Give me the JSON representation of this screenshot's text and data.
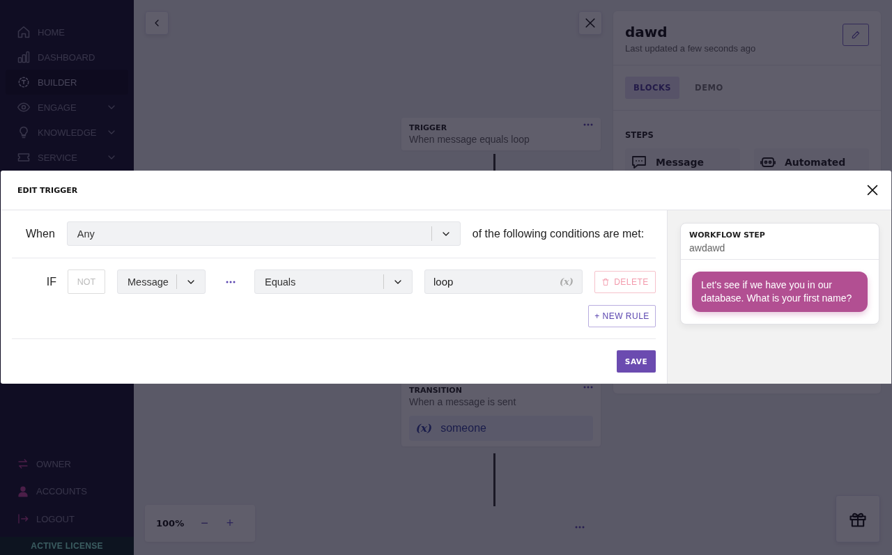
{
  "sidebar": {
    "items": [
      {
        "label": "HOME",
        "selected": false,
        "expandable": false
      },
      {
        "label": "DASHBOARD",
        "selected": false,
        "expandable": false
      },
      {
        "label": "BUILDER",
        "selected": true,
        "expandable": false
      },
      {
        "label": "ENGAGE",
        "selected": false,
        "expandable": true
      },
      {
        "label": "KNOWLEDGE",
        "selected": false,
        "expandable": true
      },
      {
        "label": "SERVICE",
        "selected": false,
        "expandable": true
      }
    ],
    "bottom_items": [
      {
        "label": "OWNER"
      },
      {
        "label": "ACCOUNTS"
      },
      {
        "label": "LOGOUT"
      }
    ],
    "license": "ACTIVE LICENSE"
  },
  "canvas": {
    "nodes": [
      {
        "kind": "trigger",
        "title": "TRIGGER",
        "subtitle": "When message equals loop"
      },
      {
        "kind": "transition",
        "title": "TRANSITION",
        "subtitle": "When a message is sent",
        "variable_icon": "(x)",
        "variable": "someone"
      }
    ],
    "zoom": {
      "value": "100%",
      "zoom_out": "−",
      "zoom_in": "+"
    }
  },
  "panel": {
    "title": "dawd",
    "updated": "Last updated a few seconds ago",
    "tabs": [
      {
        "label": "BLOCKS",
        "selected": true
      },
      {
        "label": "DEMO",
        "selected": false
      }
    ],
    "steps_heading": "STEPS",
    "steps": [
      {
        "label": "Message"
      },
      {
        "label": "Automated"
      }
    ]
  },
  "modal": {
    "title": "EDIT TRIGGER",
    "when_label": "When",
    "match": "Any",
    "match_suffix": "of the following conditions are met:",
    "rules": [
      {
        "prefix": "IF",
        "not_label": "NOT",
        "negated": false,
        "field": "Message",
        "operator": "Equals",
        "value": "loop",
        "variable_icon": "(x)",
        "delete": "DELETE"
      }
    ],
    "new_rule": "+ NEW RULE",
    "save": "SAVE",
    "preview": {
      "heading": "WORKFLOW STEP",
      "name": "awdawd",
      "message": "Let's see if we have you in our database. What is your first name?"
    }
  }
}
